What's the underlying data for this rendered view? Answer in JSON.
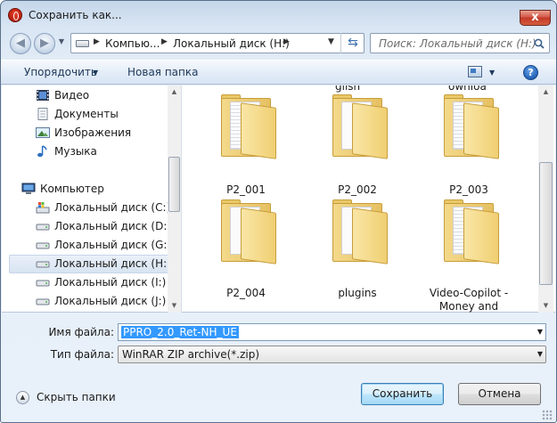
{
  "window": {
    "title": "Сохранить как...",
    "close_label": "x"
  },
  "nav": {
    "back_icon": "back-arrow-icon",
    "forward_icon": "forward-arrow-icon",
    "breadcrumbs": [
      "Компью...",
      "Локальный диск (H:)"
    ],
    "search_placeholder": "Поиск: Локальный диск (H:)"
  },
  "toolbar": {
    "organize_label": "Упорядочить",
    "new_folder_label": "Новая папка",
    "help_label": "?"
  },
  "sidebar": {
    "items": [
      {
        "label": "Видео",
        "icon": "video-library-icon"
      },
      {
        "label": "Документы",
        "icon": "documents-library-icon"
      },
      {
        "label": "Изображения",
        "icon": "pictures-library-icon"
      },
      {
        "label": "Музыка",
        "icon": "music-library-icon"
      },
      {
        "label": "Компьютер",
        "icon": "computer-icon"
      },
      {
        "label": "Локальный диск (C:)",
        "icon": "system-drive-icon"
      },
      {
        "label": "Локальный диск (D:)",
        "icon": "drive-icon"
      },
      {
        "label": "Локальный диск (G:)",
        "icon": "drive-icon"
      },
      {
        "label": "Локальный диск (H:)",
        "icon": "drive-icon",
        "selected": true
      },
      {
        "label": "Локальный диск (I:)",
        "icon": "drive-icon"
      },
      {
        "label": "Локальный диск (J:)",
        "icon": "drive-icon"
      }
    ]
  },
  "files": {
    "partial_top": [
      "glish",
      "ownloa"
    ],
    "items": [
      {
        "label": "P2_001",
        "paper": "lined"
      },
      {
        "label": "P2_002",
        "paper": "blank"
      },
      {
        "label": "P2_003",
        "paper": "lined"
      },
      {
        "label": "P2_004",
        "paper": "blank"
      },
      {
        "label": "plugins",
        "paper": "blank"
      },
      {
        "label": "Video-Copilot -\nMoney and",
        "paper": "lined"
      }
    ]
  },
  "form": {
    "filename_label": "Имя файла:",
    "filename_value": "PPRO_2.0_Ret-NH_UE",
    "filetype_label": "Тип файла:",
    "filetype_value": "WinRAR ZIP archive(*.zip)"
  },
  "footer": {
    "hide_folders_label": "Скрыть папки",
    "save_label": "Сохранить",
    "cancel_label": "Отмена"
  },
  "colors": {
    "selection": "#3399ff",
    "folder": "#f0cf72",
    "close_button": "#c33927"
  }
}
